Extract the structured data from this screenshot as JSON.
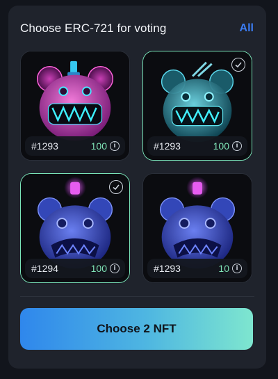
{
  "header": {
    "title": "Choose ERC-721 for voting",
    "all_label": "All"
  },
  "nfts": [
    {
      "id": "#1293",
      "votes": "100",
      "selected": false,
      "art": "pink-neon-bear"
    },
    {
      "id": "#1293",
      "votes": "100",
      "selected": true,
      "art": "cyan-glass-bear"
    },
    {
      "id": "#1294",
      "votes": "100",
      "selected": true,
      "art": "blue-glass-bear"
    },
    {
      "id": "#1293",
      "votes": "10",
      "selected": false,
      "art": "blue-glass-bear"
    }
  ],
  "cta": {
    "label": "Choose 2 NFT"
  },
  "icons": {
    "info": "info-icon",
    "check": "check-icon"
  },
  "colors": {
    "accent": "#79e3b8",
    "link": "#3b7cf2",
    "vote": "#7fe4b6"
  }
}
